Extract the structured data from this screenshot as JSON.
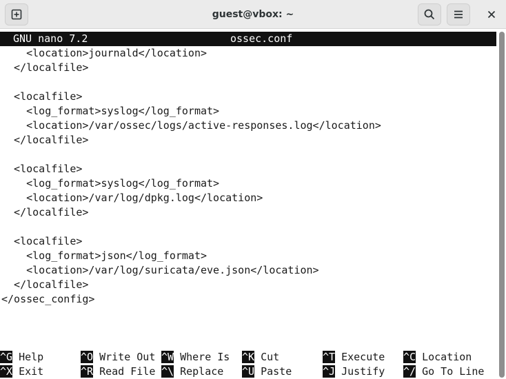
{
  "window": {
    "title": "guest@vbox: ~"
  },
  "icons": {
    "new_tab": "new-tab-icon",
    "search": "search-icon",
    "menu": "hamburger-menu-icon",
    "close": "close-icon"
  },
  "nano": {
    "version": "GNU nano 7.2",
    "filename": "ossec.conf",
    "lines": [
      "    <location>journald</location>",
      "  </localfile>",
      "",
      "  <localfile>",
      "    <log_format>syslog</log_format>",
      "    <location>/var/ossec/logs/active-responses.log</location>",
      "  </localfile>",
      "",
      "  <localfile>",
      "    <log_format>syslog</log_format>",
      "    <location>/var/log/dpkg.log</location>",
      "  </localfile>",
      "",
      "  <localfile>",
      "    <log_format>json</log_format>",
      "    <location>/var/log/suricata/eve.json</location>",
      "  </localfile>",
      "</ossec_config>"
    ],
    "shortcuts": [
      {
        "key": "^G",
        "label": "Help"
      },
      {
        "key": "^O",
        "label": "Write Out"
      },
      {
        "key": "^W",
        "label": "Where Is"
      },
      {
        "key": "^K",
        "label": "Cut"
      },
      {
        "key": "^T",
        "label": "Execute"
      },
      {
        "key": "^C",
        "label": "Location"
      },
      {
        "key": "^X",
        "label": "Exit"
      },
      {
        "key": "^R",
        "label": "Read File"
      },
      {
        "key": "^\\",
        "label": "Replace"
      },
      {
        "key": "^U",
        "label": "Paste"
      },
      {
        "key": "^J",
        "label": "Justify"
      },
      {
        "key": "^/",
        "label": "Go To Line"
      }
    ]
  },
  "colors": {
    "titlebar_bg": "#ebebeb",
    "header_bg": "#111111",
    "text": "#1a1a1a"
  }
}
